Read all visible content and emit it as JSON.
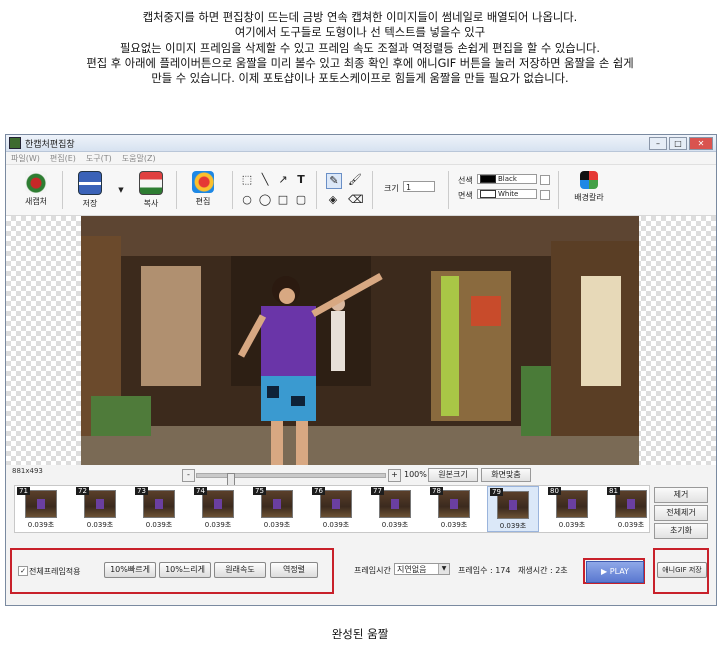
{
  "caption": {
    "lines": [
      "캡처중지를 하면 편집창이 뜨는데 금방 연속 캡쳐한 이미지들이 썸네일로 배열되어 나옵니다.",
      "여기에서 도구들로 도형이나 선 텍스트를 넣을수 있구",
      "필요없는 이미지 프레임을 삭제할 수 있고  프레임 속도 조절과 역정렬등 손쉽게 편집을 할 수 있습니다.",
      "편집 후 아래에 플레이버튼으로 움짤을 미리 볼수 있고 최종 확인 후에 애니GIF 버튼을 눌러 저장하면  움짤을 손 쉽게",
      "만들 수 있습니다. 이제 포토샵이나 포토스케이프로 힘들게 움짤을 만들 필요가 없습니다."
    ],
    "bottom": "완성된 움짤"
  },
  "window": {
    "title": "한캡처편집창",
    "menu": [
      "파일(W)",
      "편집(E)",
      "도구(T)",
      "도움말(Z)"
    ]
  },
  "toolbar": {
    "new_capture": "새캡처",
    "save": "저장",
    "copy": "복사",
    "edit": "편집",
    "size_label": "크기",
    "size_value": "1",
    "line_label": "선색",
    "line_color": "Black",
    "face_label": "면색",
    "face_color": "White",
    "bg_color": "배경칼라"
  },
  "canvas": {
    "dimensions": "881x493"
  },
  "zoom": {
    "minus": "-",
    "plus": "+",
    "level": "100%",
    "original_size": "원본크기",
    "fit_screen": "화면맞춤"
  },
  "frames": [
    {
      "num": "71",
      "delay": "0.039초"
    },
    {
      "num": "72",
      "delay": "0.039초"
    },
    {
      "num": "73",
      "delay": "0.039초"
    },
    {
      "num": "74",
      "delay": "0.039초"
    },
    {
      "num": "75",
      "delay": "0.039초"
    },
    {
      "num": "76",
      "delay": "0.039초"
    },
    {
      "num": "77",
      "delay": "0.039초"
    },
    {
      "num": "78",
      "delay": "0.039초"
    },
    {
      "num": "79",
      "delay": "0.039초"
    },
    {
      "num": "80",
      "delay": "0.039초"
    },
    {
      "num": "81",
      "delay": "0.039초"
    }
  ],
  "side_buttons": {
    "delete": "제거",
    "delete_all": "전체제거",
    "reset": "초기화"
  },
  "options": {
    "apply_all": "전체프레임적용",
    "faster": "10%빠르게",
    "slower": "10%느리게",
    "original_speed": "원래속도",
    "reverse": "역정렬",
    "frame_time_label": "프레임시간",
    "frame_time_value": "지연없음",
    "frame_count": "프레임수 : 174",
    "play_time": "재생시간 : 2초",
    "play": "▶ PLAY",
    "save_gif": "애니GIF 저장"
  },
  "colors": {
    "highlight_red": "#c8202a",
    "play_blue": "#5a78d0"
  }
}
